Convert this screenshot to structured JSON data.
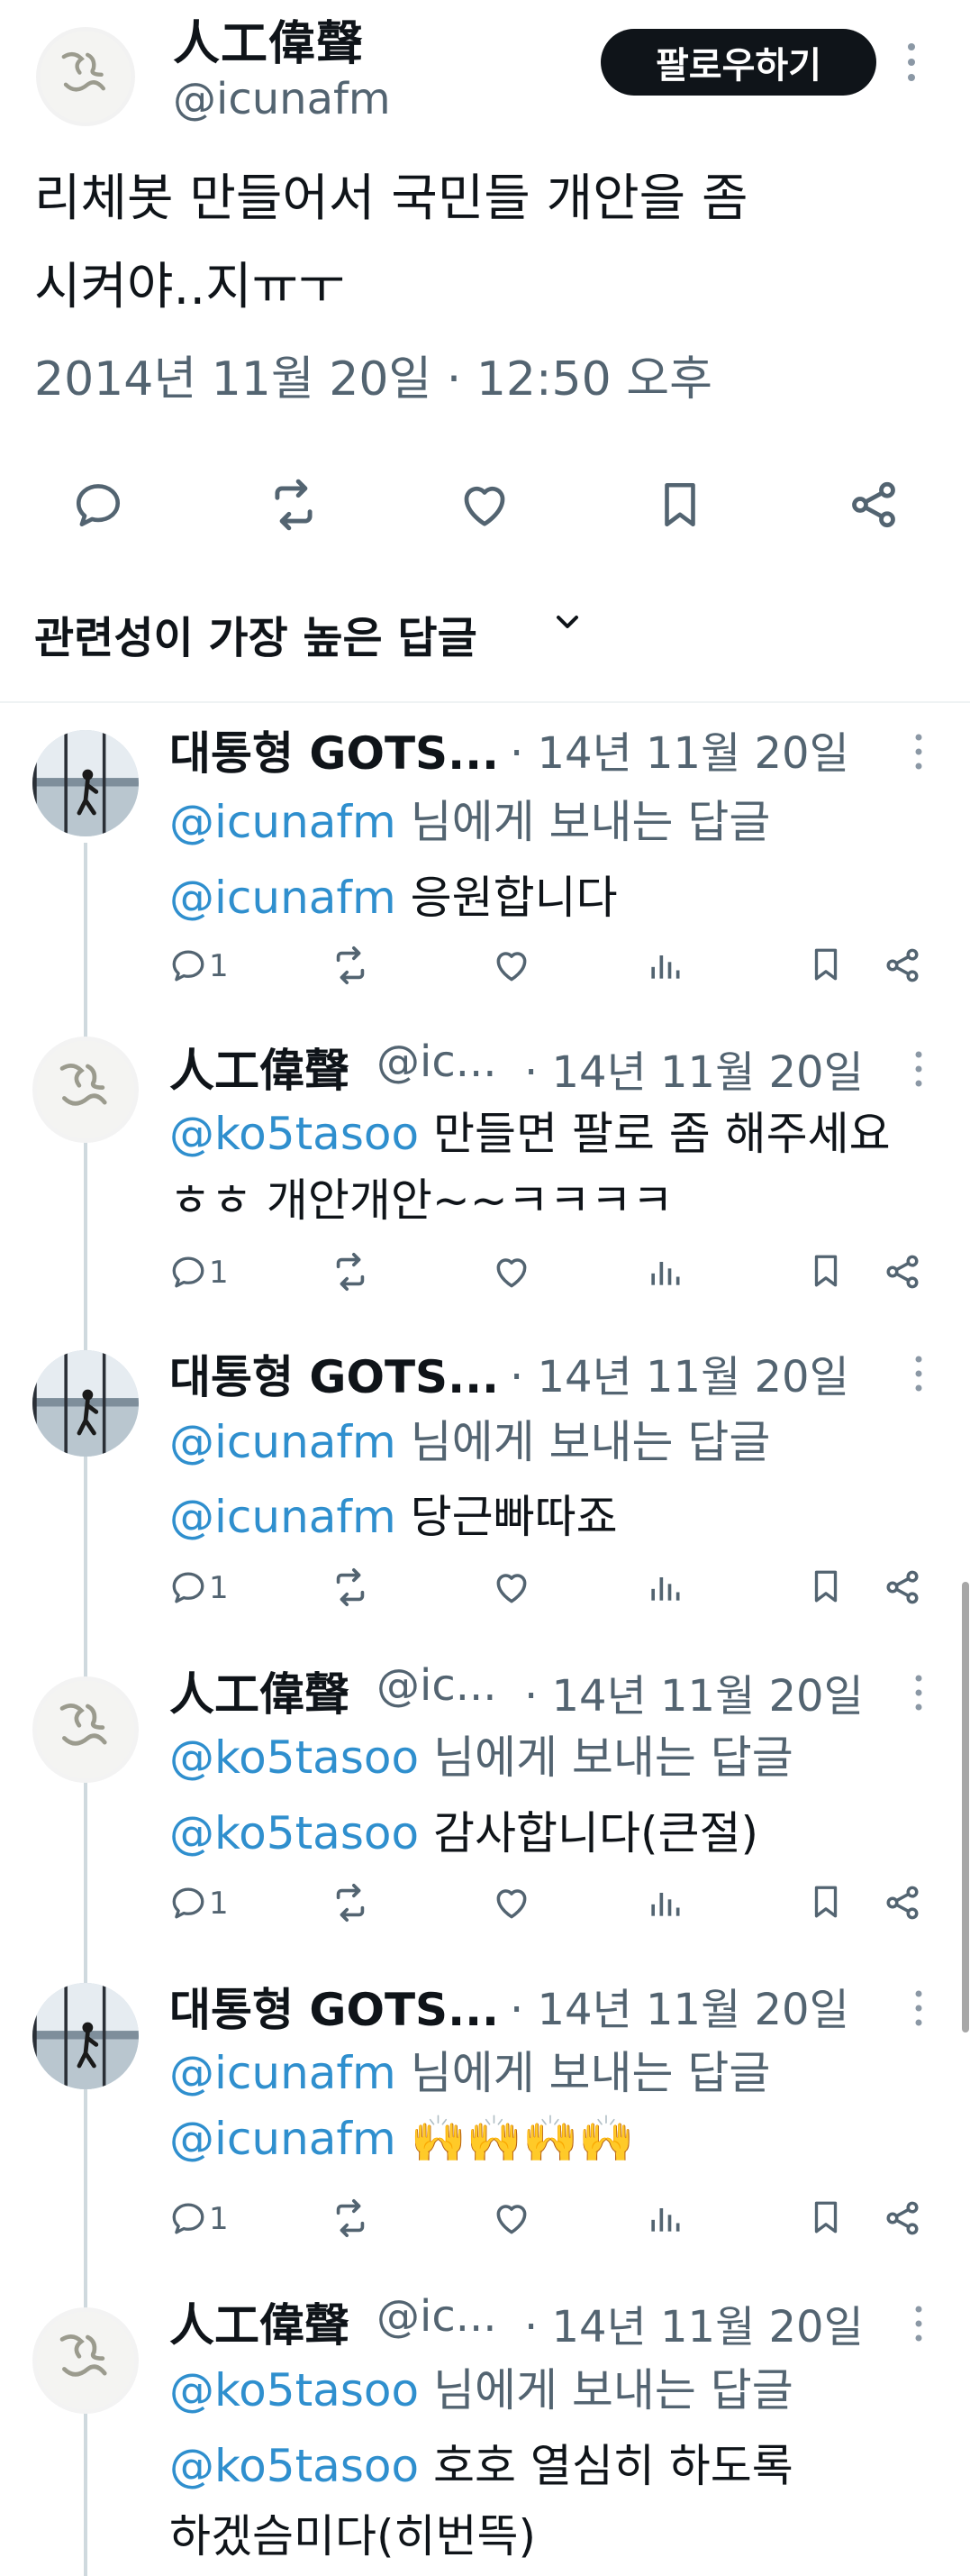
{
  "main_tweet": {
    "display_name": "人工偉聲",
    "handle": "@icunafm",
    "follow_label": "팔로우하기",
    "text_line1": "리체봇 만들어서 국민들 개안을 좀",
    "text_line2": "시켜야..지ㅠㅜ",
    "timestamp": "2014년 11월 20일 · 12:50 오후"
  },
  "sort": {
    "label": "관련성이 가장 높은 답글"
  },
  "replies": [
    {
      "name": "대통형 GOTS...",
      "date": "· 14년 11월 20일",
      "line1_mention": "@icunafm",
      "line1_text": " 님에게 보내는 답글",
      "line2_mention": "@icunafm",
      "line2_text": " 응원합니다",
      "reply_count": "1"
    },
    {
      "name": "人工偉聲",
      "handle": "@ic...",
      "date": "· 14년 11월 20일",
      "line1_mention": "@ko5tasoo",
      "line1_text": " 만들면 팔로 좀 해주세요",
      "line2_text": "ㅎㅎ 개안개안~~ㅋㅋㅋㅋ",
      "reply_count": "1"
    },
    {
      "name": "대통형 GOTS...",
      "date": "· 14년 11월 20일",
      "line1_mention": "@icunafm",
      "line1_text": " 님에게 보내는 답글",
      "line2_mention": "@icunafm",
      "line2_text": " 당근빠따죠",
      "reply_count": "1"
    },
    {
      "name": "人工偉聲",
      "handle": "@ic...",
      "date": "· 14년 11월 20일",
      "line1_mention": "@ko5tasoo",
      "line1_text": " 님에게 보내는 답글",
      "line2_mention": "@ko5tasoo",
      "line2_text": " 감사합니다(큰절)",
      "reply_count": "1"
    },
    {
      "name": "대통형 GOTS...",
      "date": "· 14년 11월 20일",
      "line1_mention": "@icunafm",
      "line1_text": " 님에게 보내는 답글",
      "line2_mention": "@icunafm",
      "line2_text": " 🙌🙌🙌🙌",
      "reply_count": "1"
    },
    {
      "name": "人工偉聲",
      "handle": "@ic...",
      "date": "· 14년 11월 20일",
      "line1_mention": "@ko5tasoo",
      "line1_text": " 님에게 보내는 답글",
      "line2_mention": "@ko5tasoo",
      "line2_text": " 호호 열심히 하도록",
      "line3_text": "하겠슴미다(히번뜩)"
    }
  ],
  "colors": {
    "text": "#0f1419",
    "secondary": "#536471",
    "mention": "#2f8fce",
    "follow_bg": "#0f1419"
  },
  "icons": [
    "reply-icon",
    "retweet-icon",
    "like-icon",
    "bookmark-icon",
    "share-icon",
    "views-icon",
    "more-icon",
    "chevron-down-icon"
  ]
}
